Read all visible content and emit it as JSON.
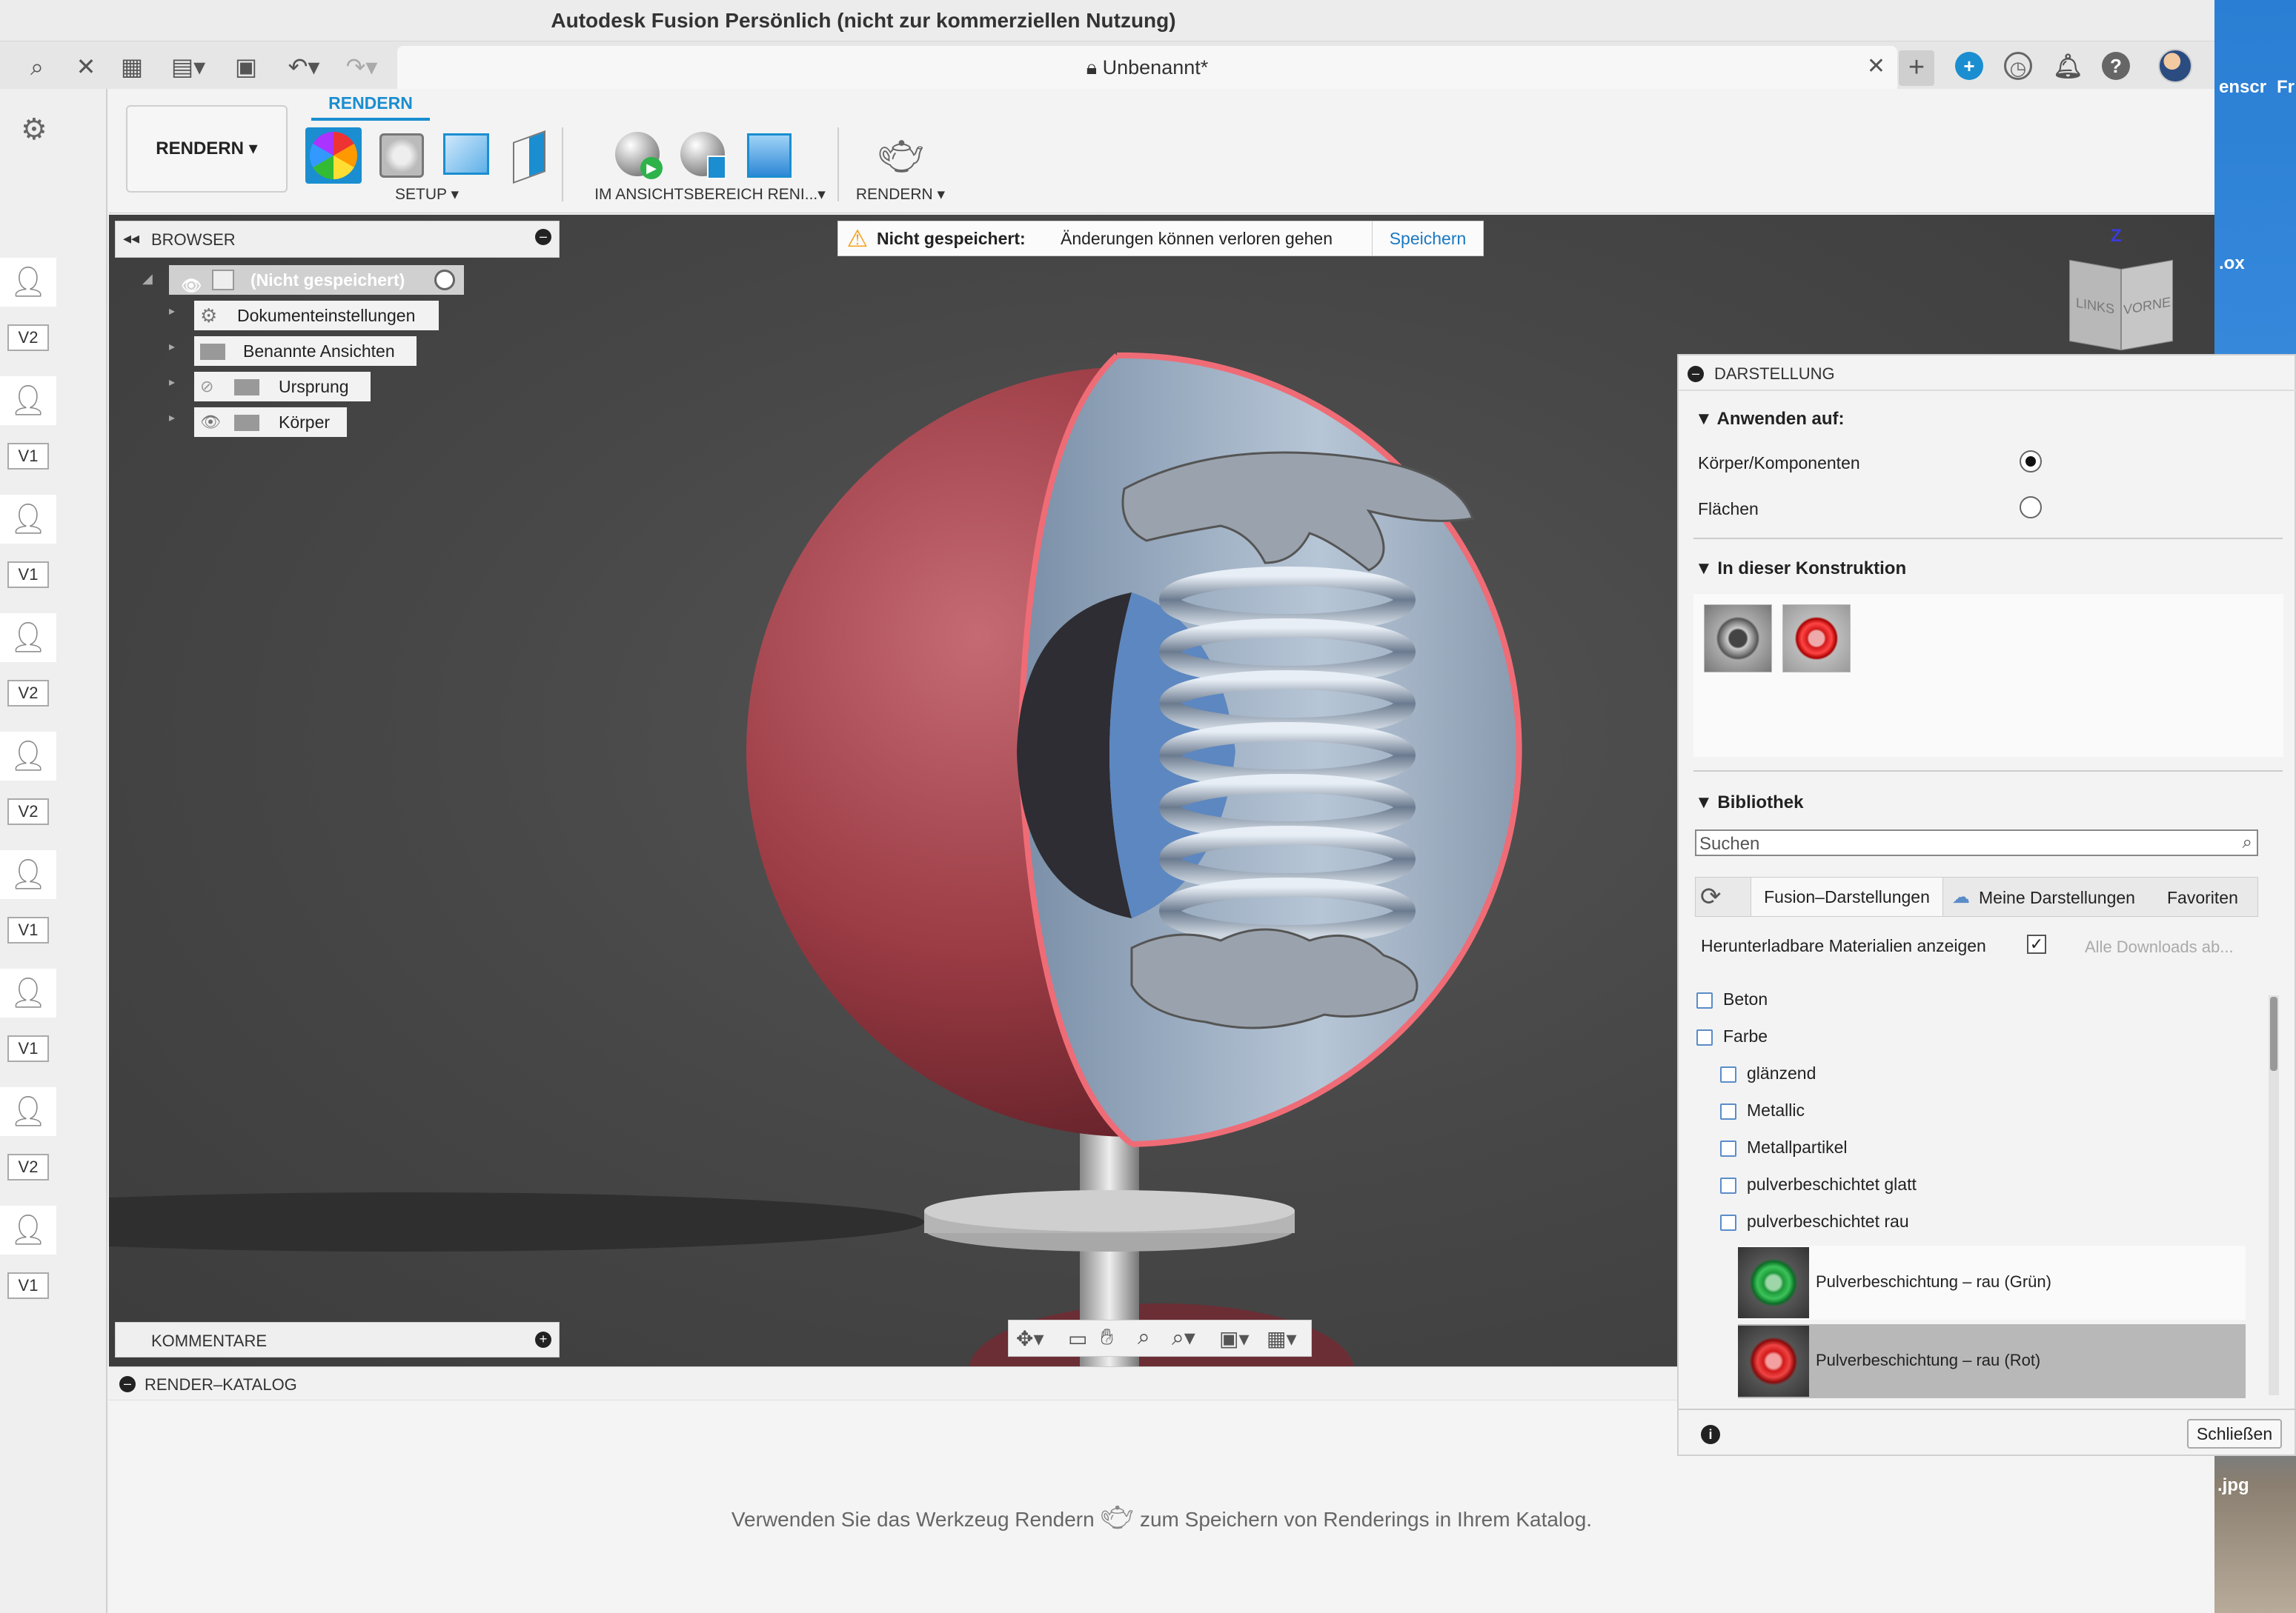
{
  "window": {
    "title": "Autodesk Fusion Persönlich (nicht zur kommerziellen Nutzung)"
  },
  "document_tab": {
    "name": "Unbenannt*"
  },
  "desktop": {
    "label_1": "enscr",
    "label_2": "Fr",
    "label_3": ".ox",
    "label_4": ".jpg"
  },
  "left_strip": {
    "versions": [
      "V2",
      "V1",
      "V1",
      "V2",
      "V2",
      "V1",
      "V1",
      "V2",
      "V1"
    ]
  },
  "ribbon": {
    "workspace": "RENDERN",
    "active_tab": "RENDERN",
    "groups": {
      "setup": "SETUP",
      "viewport_render": "IM ANSICHTSBEREICH RENI...",
      "render": "RENDERN"
    }
  },
  "browser": {
    "header": "BROWSER",
    "root": "(Nicht gespeichert)",
    "items": [
      "Dokumenteinstellungen",
      "Benannte Ansichten",
      "Ursprung",
      "Körper"
    ]
  },
  "warning": {
    "title": "Nicht gespeichert:",
    "message": "Änderungen können verloren gehen",
    "save": "Speichern"
  },
  "viewcube": {
    "left": "LINKS",
    "front": "VORNE",
    "z": "Z"
  },
  "comments": {
    "header": "KOMMENTARE"
  },
  "catalog": {
    "header": "RENDER–KATALOG",
    "message_prefix": "Verwenden Sie das Werkzeug Rendern",
    "message_suffix": "zum Speichern von Renderings in Ihrem Katalog."
  },
  "appearance": {
    "header": "DARSTELLUNG",
    "apply_to": {
      "title": "Anwenden auf:",
      "option_bodies": "Körper/Komponenten",
      "option_faces": "Flächen",
      "selected": "Körper/Komponenten"
    },
    "in_design": {
      "title": "In dieser Konstruktion"
    },
    "library": {
      "title": "Bibliothek",
      "search_placeholder": "Suchen",
      "tabs": [
        "Fusion–Darstellungen",
        "Meine Darstellungen",
        "Favoriten"
      ],
      "downloadable_label": "Herunterladbare Materialien anzeigen",
      "downloadable_checked": true,
      "all_downloads": "Alle Downloads ab...",
      "tree": [
        {
          "label": "Beton",
          "level": 0
        },
        {
          "label": "Farbe",
          "level": 0
        },
        {
          "label": "glänzend",
          "level": 1
        },
        {
          "label": "Metallic",
          "level": 1
        },
        {
          "label": "Metallpartikel",
          "level": 1
        },
        {
          "label": "pulverbeschichtet glatt",
          "level": 1
        },
        {
          "label": "pulverbeschichtet rau",
          "level": 1
        }
      ],
      "materials": [
        {
          "name": "Pulverbeschichtung – rau (Grün)",
          "color": "#1e9a3a",
          "selected": false
        },
        {
          "name": "Pulverbeschichtung – rau (Rot)",
          "color": "#d21a1a",
          "selected": true
        }
      ]
    },
    "close": "Schließen"
  },
  "colors": {
    "accent": "#1a8ed0",
    "sphere": "#9b3b44",
    "warning": "#f39c12"
  }
}
